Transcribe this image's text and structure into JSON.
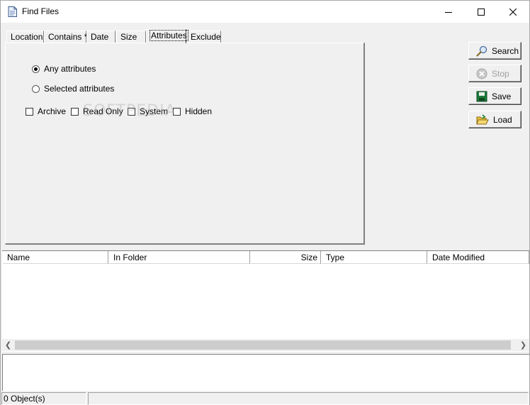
{
  "window": {
    "title": "Find Files"
  },
  "tabs": [
    {
      "label": "Location"
    },
    {
      "label": "Contains *"
    },
    {
      "label": "Date"
    },
    {
      "label": "Size"
    },
    {
      "label": "Attributes",
      "active": true
    },
    {
      "label": "Exclude"
    }
  ],
  "attributes": {
    "any_label": "Any attributes",
    "selected_label": "Selected attributes",
    "mode": "any",
    "checks": [
      {
        "label": "Archive",
        "checked": false
      },
      {
        "label": "Read Only",
        "checked": false
      },
      {
        "label": "System",
        "checked": false
      },
      {
        "label": "Hidden",
        "checked": false
      }
    ]
  },
  "buttons": {
    "search": "Search",
    "stop": "Stop",
    "save": "Save",
    "load": "Load"
  },
  "list": {
    "columns": [
      "Name",
      "In Folder",
      "Size",
      "Type",
      "Date Modified"
    ]
  },
  "status": {
    "objects": "0 Object(s)"
  },
  "watermark": "SOFTPEDIA"
}
